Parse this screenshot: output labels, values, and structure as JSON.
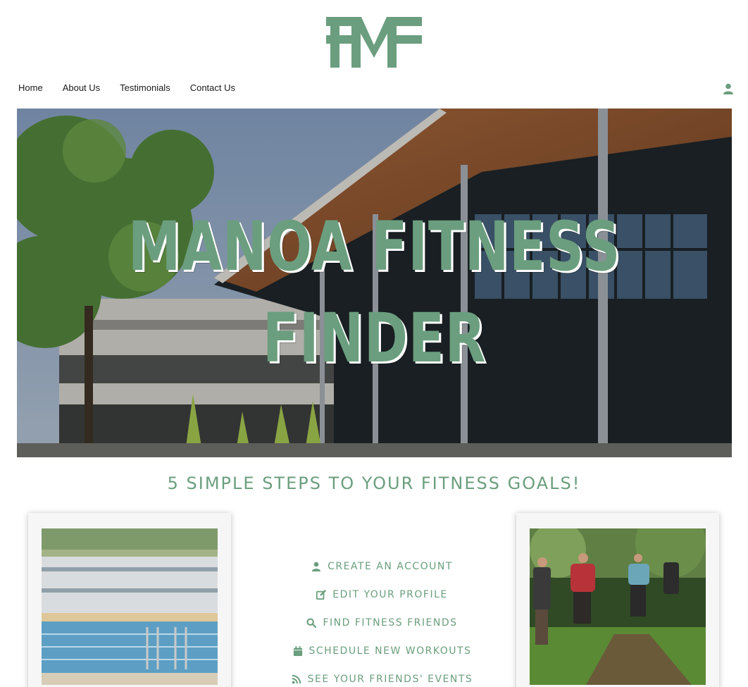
{
  "logo": {
    "text": "FMF",
    "icon": "fmf-logo-icon"
  },
  "nav": {
    "items": [
      "Home",
      "About Us",
      "Testimonials",
      "Contact Us"
    ],
    "user_icon": "user-icon"
  },
  "hero": {
    "title_line1": "MANOA FITNESS",
    "title_line2": "FINDER"
  },
  "steps_heading": "5 SIMPLE STEPS TO YOUR FITNESS GOALS!",
  "steps": [
    {
      "label": "CREATE AN ACCOUNT",
      "icon": "user-icon"
    },
    {
      "label": "EDIT YOUR PROFILE",
      "icon": "edit-icon"
    },
    {
      "label": "FIND FITNESS FRIENDS",
      "icon": "search-icon"
    },
    {
      "label": "SCHEDULE NEW WORKOUTS",
      "icon": "calendar-icon"
    },
    {
      "label": "SEE YOUR FRIENDS' EVENTS",
      "icon": "rss-icon"
    }
  ],
  "colors": {
    "accent": "#6b9e7e",
    "text": "#1a1a1a",
    "background": "#ffffff"
  }
}
